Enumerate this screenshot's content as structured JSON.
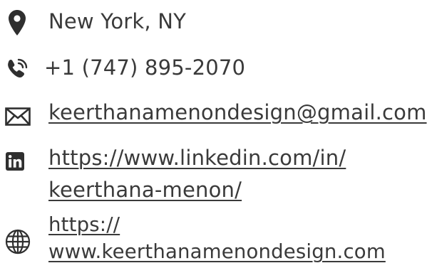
{
  "contact": {
    "location": {
      "icon": "map-pin-icon",
      "text": "New York, NY"
    },
    "phone": {
      "icon": "phone-call-icon",
      "text": "+1 (747) 895-2070"
    },
    "email": {
      "icon": "envelope-icon",
      "text": "keerthanamenondesign@gmail.com"
    },
    "linkedin": {
      "icon": "linkedin-icon",
      "line1": "https://www.linkedin.com/in/",
      "line2": "keerthana-menon/"
    },
    "website": {
      "icon": "globe-icon",
      "line1": "https://",
      "line2": "www.keerthanamenondesign.com"
    }
  },
  "colors": {
    "text": "#3a3a3a",
    "icon": "#2f2f2f"
  }
}
